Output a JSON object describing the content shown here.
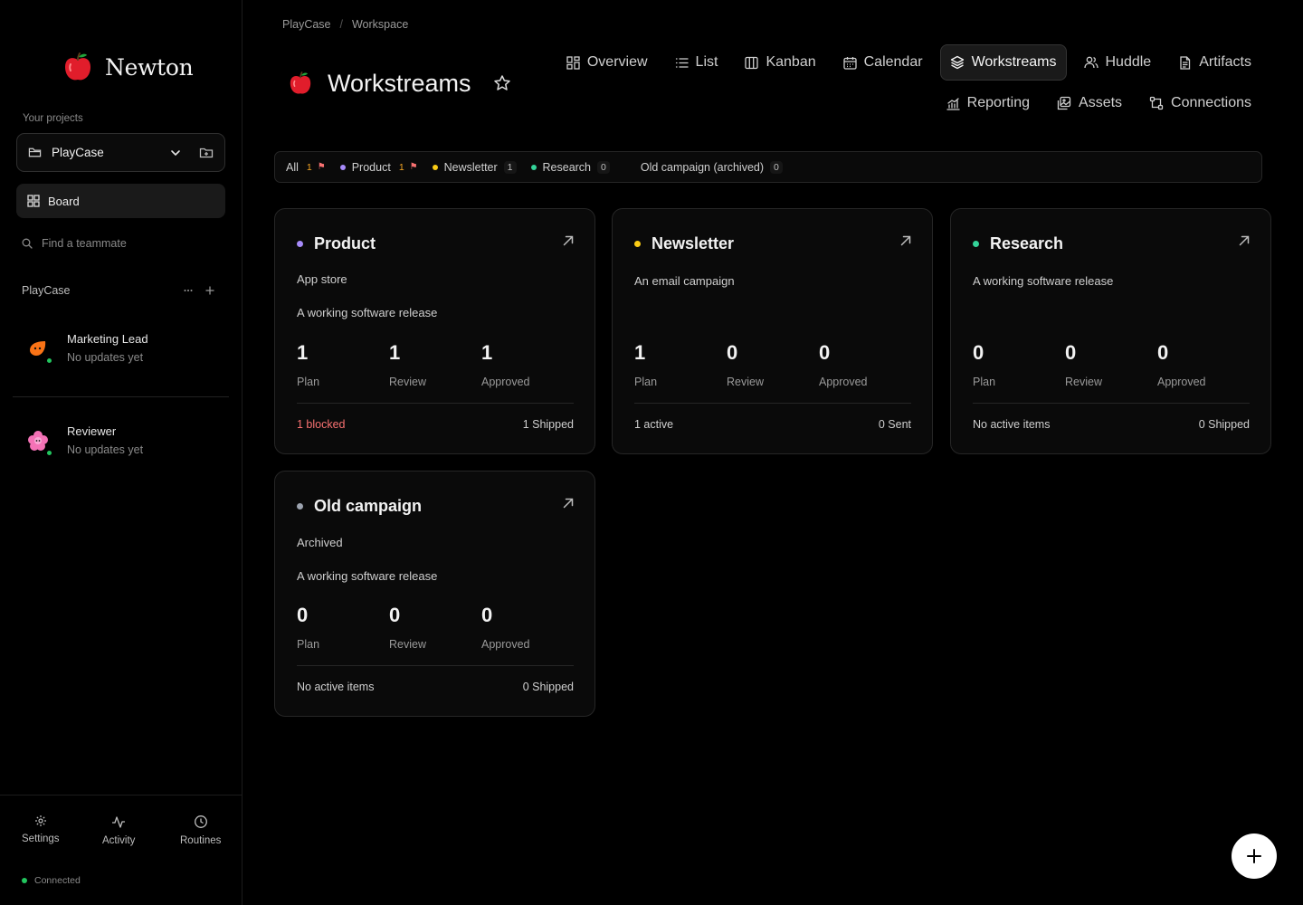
{
  "app": {
    "name": "Newton"
  },
  "sidebar": {
    "projects_label": "Your projects",
    "project_select": "PlayCase",
    "board_label": "Board",
    "find_placeholder": "Find a teammate",
    "group_title": "PlayCase",
    "teammates": [
      {
        "name": "Marketing Lead",
        "status": "No updates yet"
      },
      {
        "name": "Reviewer",
        "status": "No updates yet"
      }
    ],
    "bottom_nav": [
      {
        "label": "Settings",
        "icon": "gear-icon"
      },
      {
        "label": "Activity",
        "icon": "activity-icon"
      },
      {
        "label": "Routines",
        "icon": "clock-icon"
      }
    ],
    "status": "Connected"
  },
  "breadcrumb": [
    "PlayCase",
    "Workspace"
  ],
  "page": {
    "title": "Workstreams"
  },
  "tabs": [
    {
      "label": "Overview",
      "icon": "grid-icon"
    },
    {
      "label": "List",
      "icon": "list-icon"
    },
    {
      "label": "Kanban",
      "icon": "kanban-icon"
    },
    {
      "label": "Calendar",
      "icon": "calendar-icon"
    },
    {
      "label": "Workstreams",
      "icon": "layers-icon",
      "active": true
    },
    {
      "label": "Huddle",
      "icon": "users-icon"
    },
    {
      "label": "Artifacts",
      "icon": "file-icon"
    },
    {
      "label": "Reporting",
      "icon": "chart-icon"
    },
    {
      "label": "Assets",
      "icon": "images-icon"
    },
    {
      "label": "Connections",
      "icon": "connections-icon"
    }
  ],
  "filters": [
    {
      "label": "All",
      "count": "1",
      "flag": true,
      "color": ""
    },
    {
      "label": "Product",
      "count": "1",
      "flag": true,
      "color": "#a78bfa"
    },
    {
      "label": "Newsletter",
      "count": "1",
      "flag": false,
      "color": "#facc15"
    },
    {
      "label": "Research",
      "count": "0",
      "flag": false,
      "color": "#34d399"
    },
    {
      "label": "Old campaign (archived)",
      "count": "0",
      "flag": false,
      "color": ""
    }
  ],
  "workstreams": [
    {
      "name": "Product",
      "color": "#a78bfa",
      "tag": "App store",
      "description": "A working software release",
      "stats": [
        {
          "value": "1",
          "label": "Plan"
        },
        {
          "value": "1",
          "label": "Review"
        },
        {
          "value": "1",
          "label": "Approved"
        }
      ],
      "footer_left": "1 blocked",
      "footer_left_danger": true,
      "footer_right": "1 Shipped"
    },
    {
      "name": "Newsletter",
      "color": "#facc15",
      "tag": "",
      "description": "An email campaign",
      "stats": [
        {
          "value": "1",
          "label": "Plan"
        },
        {
          "value": "0",
          "label": "Review"
        },
        {
          "value": "0",
          "label": "Approved"
        }
      ],
      "footer_left": "1 active",
      "footer_left_danger": false,
      "footer_right": "0 Sent"
    },
    {
      "name": "Research",
      "color": "#34d399",
      "tag": "",
      "description": "A working software release",
      "stats": [
        {
          "value": "0",
          "label": "Plan"
        },
        {
          "value": "0",
          "label": "Review"
        },
        {
          "value": "0",
          "label": "Approved"
        }
      ],
      "footer_left": "No active items",
      "footer_left_danger": false,
      "footer_right": "0 Shipped"
    },
    {
      "name": "Old campaign",
      "color": "#9ca3af",
      "tag": "Archived",
      "description": "A working software release",
      "stats": [
        {
          "value": "0",
          "label": "Plan"
        },
        {
          "value": "0",
          "label": "Review"
        },
        {
          "value": "0",
          "label": "Approved"
        }
      ],
      "footer_left": "No active items",
      "footer_left_danger": false,
      "footer_right": "0 Shipped"
    }
  ]
}
